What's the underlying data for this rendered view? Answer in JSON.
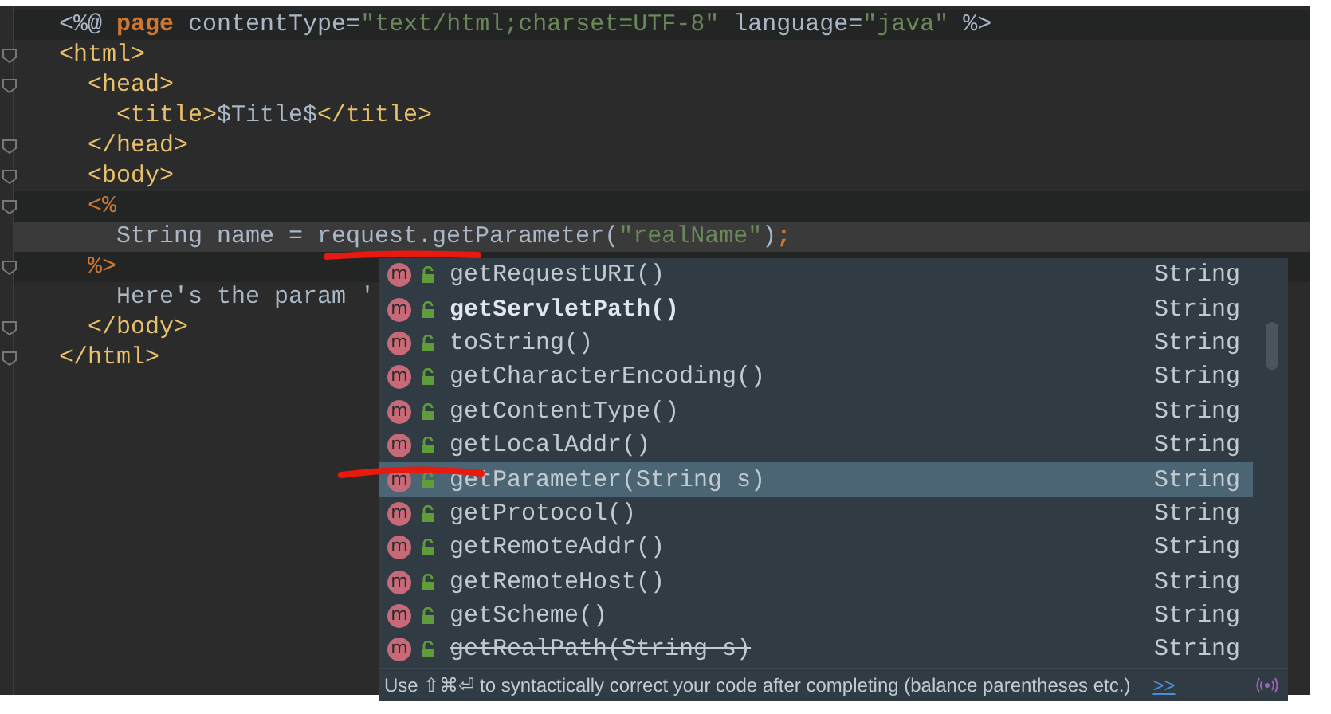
{
  "editor": {
    "lines": [
      {
        "fold": false,
        "kind": "jsp",
        "current": false,
        "tokens": [
          {
            "kind": "plain",
            "text": "<%@ "
          },
          {
            "kind": "keyword",
            "text": "page"
          },
          {
            "kind": "plain",
            "text": " contentType="
          },
          {
            "kind": "string",
            "text": "\"text/html;charset=UTF-8\""
          },
          {
            "kind": "plain",
            "text": " language="
          },
          {
            "kind": "string",
            "text": "\"java\""
          },
          {
            "kind": "plain",
            "text": " %>"
          }
        ]
      },
      {
        "fold": true,
        "kind": "markup",
        "current": false,
        "tokens": [
          {
            "kind": "tag",
            "text": "<html>"
          }
        ]
      },
      {
        "fold": true,
        "kind": "markup",
        "current": false,
        "tokens": [
          {
            "kind": "tag",
            "text": "  <head>"
          }
        ]
      },
      {
        "fold": false,
        "kind": "markup",
        "current": false,
        "tokens": [
          {
            "kind": "tag",
            "text": "    <title>"
          },
          {
            "kind": "plain",
            "text": "$Title$"
          },
          {
            "kind": "tag",
            "text": "</title>"
          }
        ]
      },
      {
        "fold": true,
        "kind": "markup",
        "current": false,
        "tokens": [
          {
            "kind": "tag",
            "text": "  </head>"
          }
        ]
      },
      {
        "fold": true,
        "kind": "markup",
        "current": false,
        "tokens": [
          {
            "kind": "tag",
            "text": "  <body>"
          }
        ]
      },
      {
        "fold": true,
        "kind": "jsp",
        "current": false,
        "tokens": [
          {
            "kind": "keyword",
            "text": "  <%"
          }
        ]
      },
      {
        "fold": false,
        "kind": "java",
        "current": true,
        "tokens": [
          {
            "kind": "plain",
            "text": "    String name = request."
          },
          {
            "kind": "plain",
            "text": "getParameter("
          },
          {
            "kind": "string",
            "text": "\"realName\""
          },
          {
            "kind": "plain",
            "text": ")"
          },
          {
            "kind": "keyword",
            "text": ";"
          }
        ]
      },
      {
        "fold": true,
        "kind": "jsp",
        "current": false,
        "tokens": [
          {
            "kind": "keyword",
            "text": "  %>"
          }
        ]
      },
      {
        "fold": false,
        "kind": "markup",
        "current": false,
        "tokens": [
          {
            "kind": "plain",
            "text": "    Here's the param '"
          }
        ]
      },
      {
        "fold": true,
        "kind": "markup",
        "current": false,
        "tokens": [
          {
            "kind": "tag",
            "text": "  </body>"
          }
        ]
      },
      {
        "fold": true,
        "kind": "markup",
        "current": false,
        "tokens": [
          {
            "kind": "tag",
            "text": "</html>"
          }
        ]
      }
    ]
  },
  "completion": {
    "items": [
      {
        "icon": "m",
        "name": "getRequestURI()",
        "type": "String",
        "selected": false,
        "bold": false,
        "deprecated": false
      },
      {
        "icon": "m",
        "name": "getServletPath()",
        "type": "String",
        "selected": false,
        "bold": true,
        "deprecated": false
      },
      {
        "icon": "m",
        "name": "toString()",
        "type": "String",
        "selected": false,
        "bold": false,
        "deprecated": false
      },
      {
        "icon": "m",
        "name": "getCharacterEncoding()",
        "type": "String",
        "selected": false,
        "bold": false,
        "deprecated": false
      },
      {
        "icon": "m",
        "name": "getContentType()",
        "type": "String",
        "selected": false,
        "bold": false,
        "deprecated": false
      },
      {
        "icon": "m",
        "name": "getLocalAddr()",
        "type": "String",
        "selected": false,
        "bold": false,
        "deprecated": false
      },
      {
        "icon": "m",
        "name": "getParameter(String s)",
        "type": "String",
        "selected": true,
        "bold": false,
        "deprecated": false
      },
      {
        "icon": "m",
        "name": "getProtocol()",
        "type": "String",
        "selected": false,
        "bold": false,
        "deprecated": false
      },
      {
        "icon": "m",
        "name": "getRemoteAddr()",
        "type": "String",
        "selected": false,
        "bold": false,
        "deprecated": false
      },
      {
        "icon": "m",
        "name": "getRemoteHost()",
        "type": "String",
        "selected": false,
        "bold": false,
        "deprecated": false
      },
      {
        "icon": "m",
        "name": "getScheme()",
        "type": "String",
        "selected": false,
        "bold": false,
        "deprecated": false
      },
      {
        "icon": "m",
        "name": "getRealPath(String s)",
        "type": "String",
        "selected": false,
        "bold": false,
        "deprecated": true
      }
    ],
    "hint": "Use ⇧⌘⏎ to syntactically correct your code after completing (balance parentheses etc.)",
    "hint_link": ">>"
  }
}
